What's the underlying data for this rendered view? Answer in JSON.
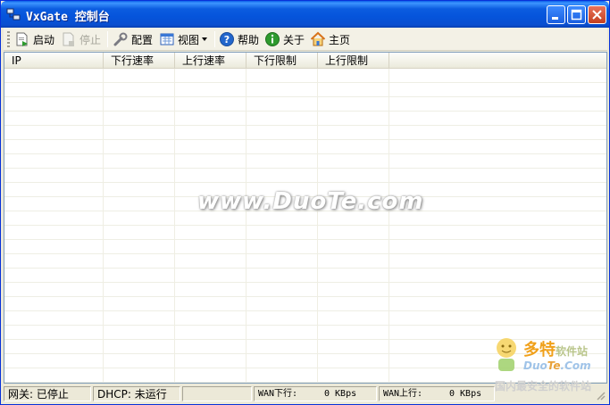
{
  "window": {
    "title": "VxGate 控制台"
  },
  "toolbar": {
    "start": "启动",
    "stop": "停止",
    "config": "配置",
    "view": "视图",
    "help": "帮助",
    "about": "关于",
    "home": "主页"
  },
  "table": {
    "columns": [
      "IP",
      "下行速率",
      "上行速率",
      "下行限制",
      "上行限制"
    ],
    "rows": []
  },
  "watermark": {
    "text": "www.DuoTe.com"
  },
  "logo": {
    "line1_main": "多特",
    "line1_sub": "软件站",
    "line2_a": "Duo",
    "line2_b": "Te",
    "line2_c": ".Com"
  },
  "status": {
    "gateway_label": "网关:",
    "gateway_value": "已停止",
    "dhcp_label": "DHCP:",
    "dhcp_value": "未运行",
    "wan_down_label": "WAN下行:",
    "wan_down_value": "0 KBps",
    "wan_up_label": "WAN上行:",
    "wan_up_value": "0 KBps",
    "overlay": "国内最安全的软件站"
  },
  "colors": {
    "title_bar": "#0554db",
    "close_button": "#c4401f"
  }
}
